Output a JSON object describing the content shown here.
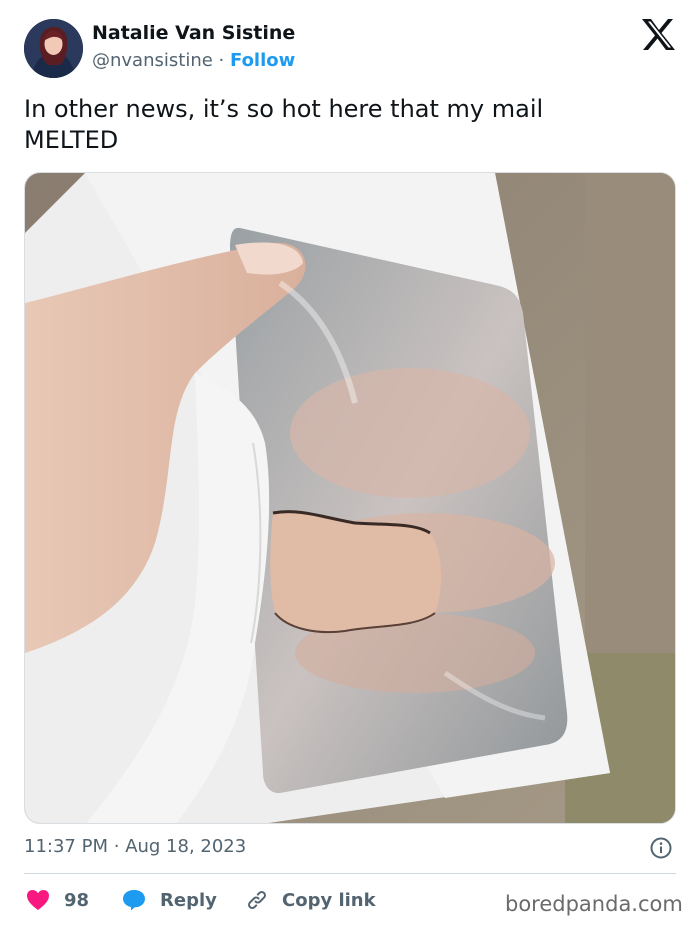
{
  "author": {
    "name": "Natalie Van Sistine",
    "handle": "@nvansistine",
    "separator": "·",
    "follow_label": "Follow"
  },
  "brand_icon": "x-logo-icon",
  "tweet": {
    "text": "In other news, it’s so hot here that my mail\nMELTED",
    "media_description_icon": "photo"
  },
  "meta": {
    "time": "11:37 PM",
    "separator": "·",
    "date": "Aug 18, 2023"
  },
  "actions": {
    "like_count": "98",
    "reply_label": "Reply",
    "copy_label": "Copy link"
  },
  "watermark": "boredpanda.com",
  "colors": {
    "accent": "#1d9bf0",
    "like": "#f91880",
    "secondary_text": "#536471",
    "primary_text": "#0f1419"
  }
}
